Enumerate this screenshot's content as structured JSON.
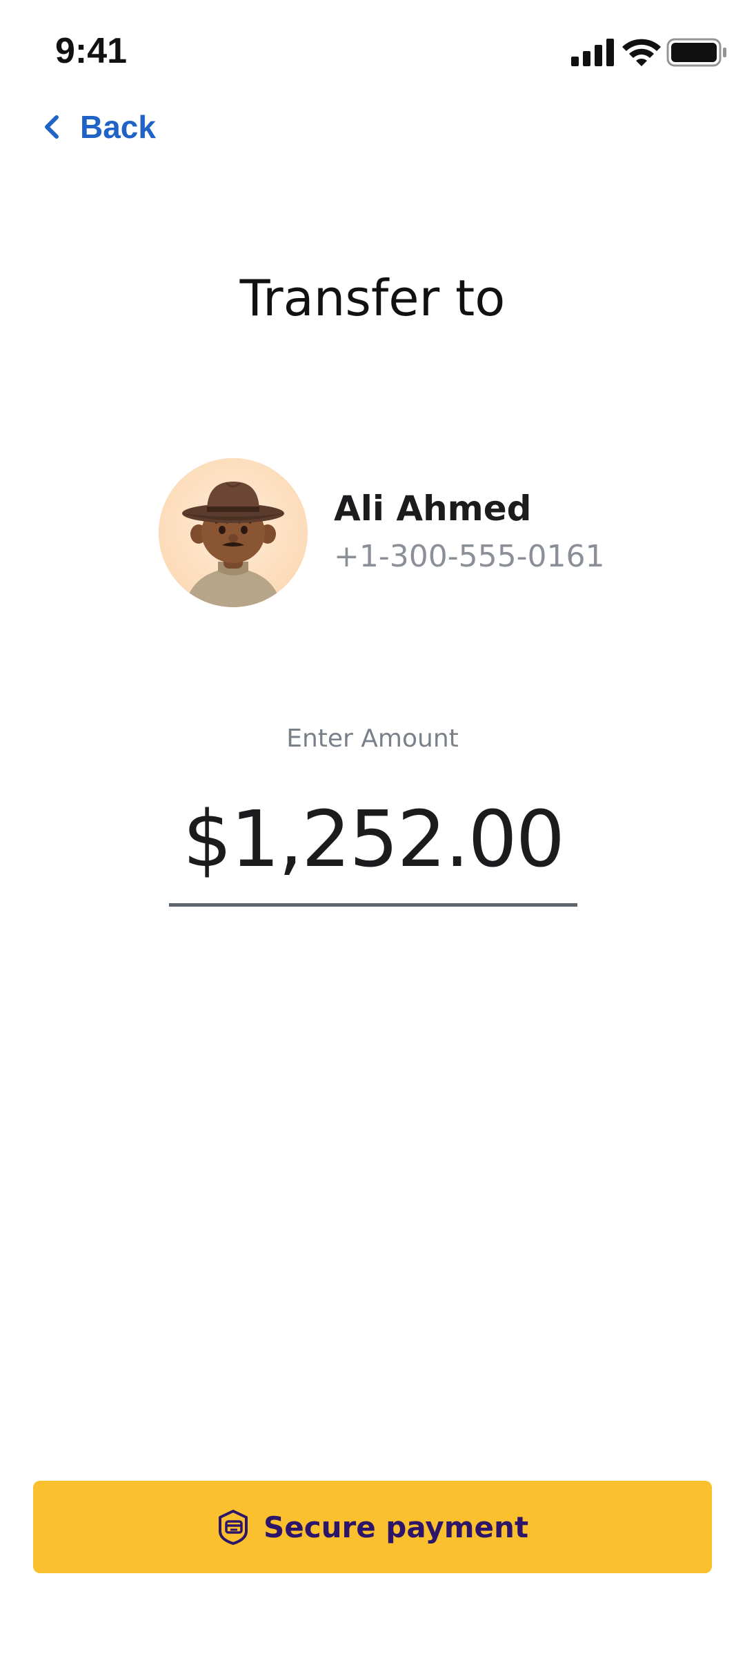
{
  "status_bar": {
    "time": "9:41",
    "icons": [
      "cellular-signal-icon",
      "wifi-icon",
      "battery-icon"
    ]
  },
  "nav": {
    "back_label": "Back",
    "back_icon": "chevron-left-icon"
  },
  "title": "Transfer to",
  "recipient": {
    "name": "Ali Ahmed",
    "phone": "+1-300-555-0161",
    "avatar_icon": "user-avatar-cowboy-hat"
  },
  "amount": {
    "label": "Enter Amount",
    "value": "$1,252.00"
  },
  "action": {
    "label": "Secure payment",
    "icon": "shield-card-icon"
  },
  "colors": {
    "accent_blue": "#1f63c7",
    "button_yellow": "#fbc02d",
    "button_text": "#2d1669",
    "muted_text": "#8a8f98",
    "underline": "#5d646e"
  }
}
